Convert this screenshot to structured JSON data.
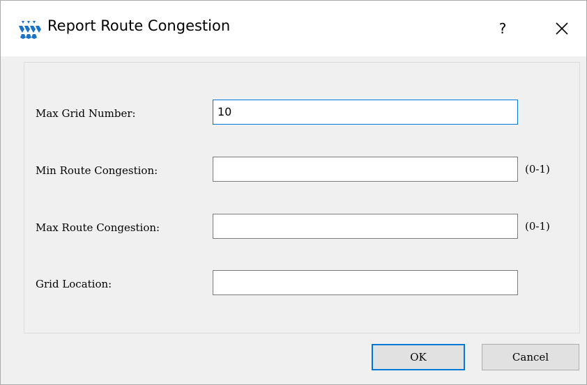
{
  "window": {
    "title": "Report Route Congestion",
    "help_label": "?",
    "icon": "gowin-logo-icon",
    "accent_color": "#0078d7"
  },
  "form": {
    "max_grid_number": {
      "label": "Max Grid Number:",
      "value": "10"
    },
    "min_route_congestion": {
      "label": "Min Route Congestion:",
      "value": "",
      "hint": "(0-1)"
    },
    "max_route_congestion": {
      "label": "Max Route Congestion:",
      "value": "",
      "hint": "(0-1)"
    },
    "grid_location": {
      "label": "Grid Location:",
      "value": ""
    }
  },
  "buttons": {
    "ok_label": "OK",
    "cancel_label": "Cancel"
  }
}
